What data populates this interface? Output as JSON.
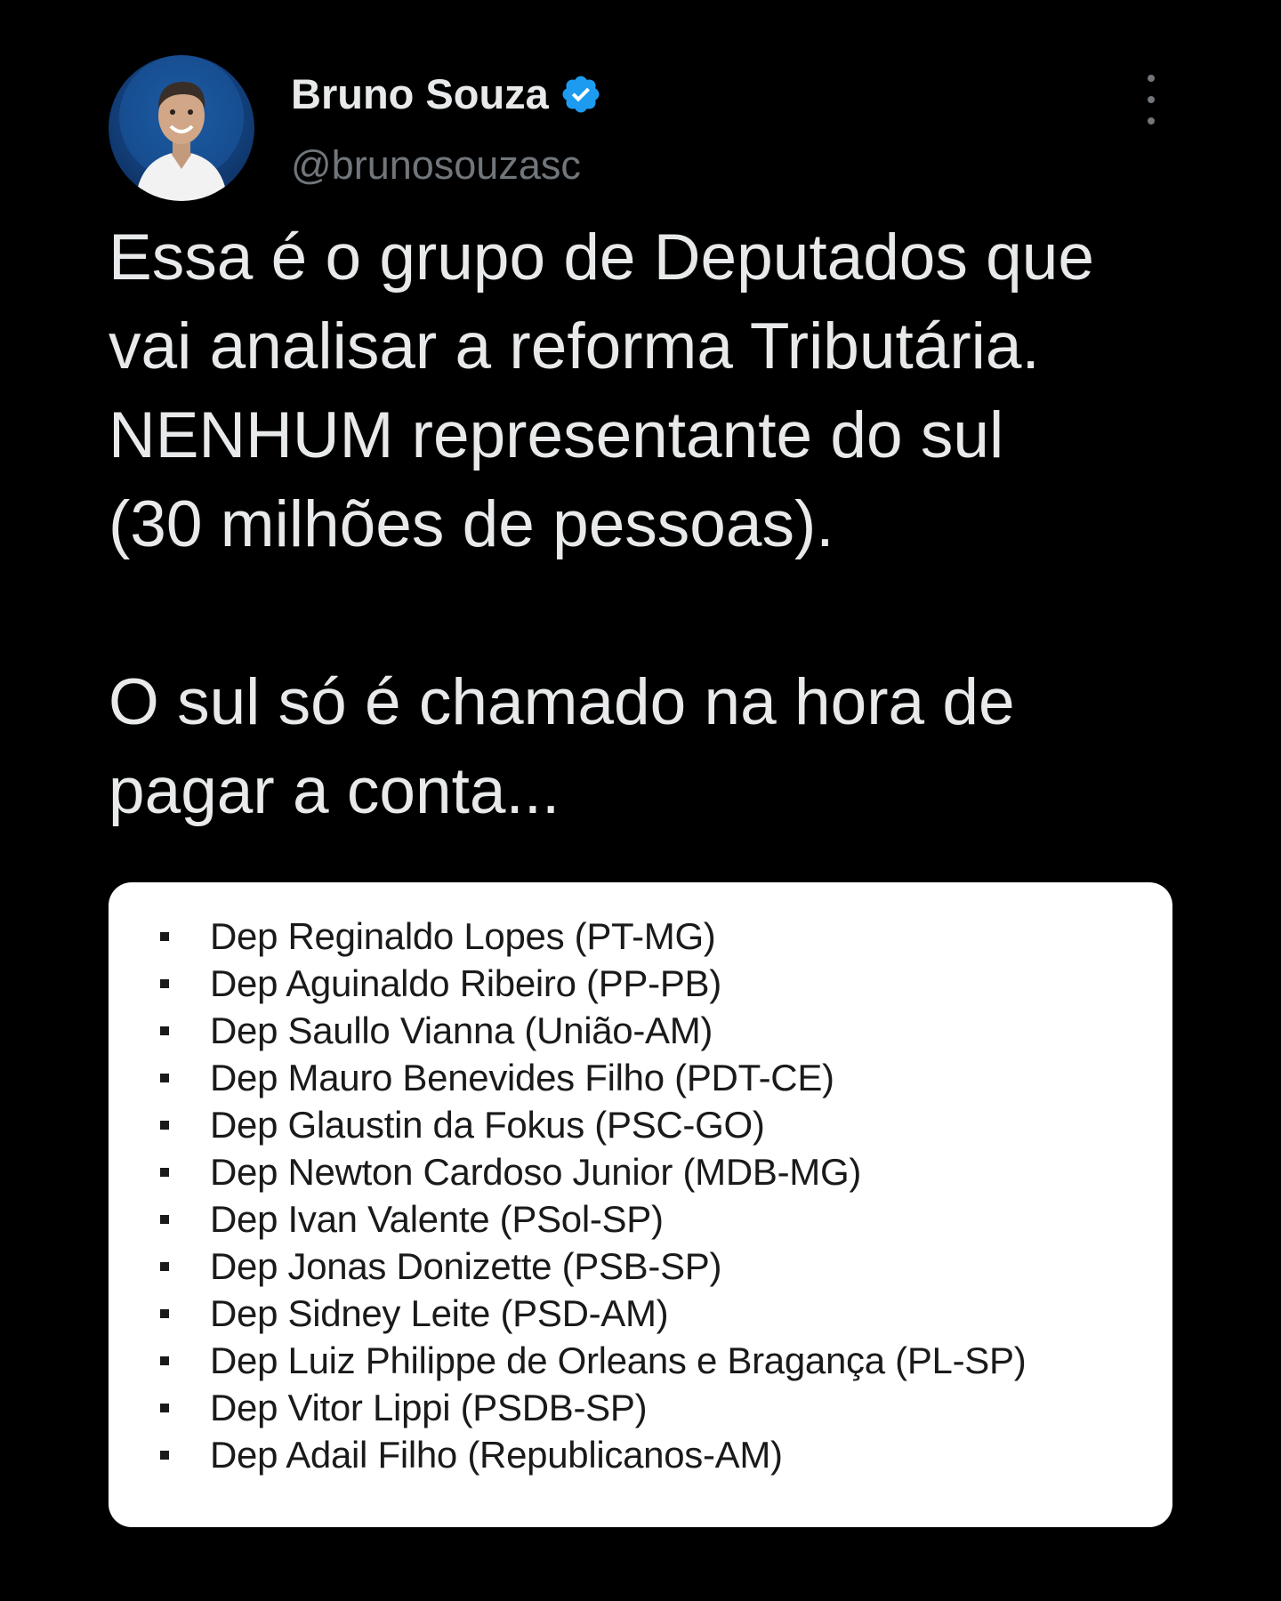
{
  "colors": {
    "background": "#000000",
    "text_primary": "#e7e9ea",
    "text_secondary": "#71767b",
    "verified_badge": "#1d9bf0",
    "media_background": "#ffffff",
    "media_text": "#1a1a1a"
  },
  "author": {
    "name": "Bruno Souza",
    "handle": "@brunosouzasc",
    "verified": true,
    "avatar_icon": "profile-photo",
    "verified_icon": "verified-badge-icon"
  },
  "menu": {
    "icon": "more-options-icon"
  },
  "tweet": {
    "paragraph_1": "Essa é o grupo de Deputados que\nvai analisar a reforma Tributária.\nNENHUM representante do sul\n(30 milhões de pessoas).",
    "paragraph_2": "O sul só é chamado na hora de\npagar a conta..."
  },
  "media": {
    "deputies": [
      "Dep Reginaldo Lopes (PT-MG)",
      "Dep Aguinaldo Ribeiro (PP-PB)",
      "Dep Saullo Vianna (União-AM)",
      "Dep Mauro Benevides Filho (PDT-CE)",
      "Dep Glaustin da Fokus (PSC-GO)",
      "Dep Newton Cardoso Junior (MDB-MG)",
      "Dep Ivan Valente (PSol-SP)",
      "Dep Jonas Donizette (PSB-SP)",
      "Dep Sidney Leite (PSD-AM)",
      "Dep Luiz Philippe de Orleans e Bragança (PL-SP)",
      "Dep Vitor Lippi (PSDB-SP)",
      "Dep Adail Filho (Republicanos-AM)"
    ]
  }
}
